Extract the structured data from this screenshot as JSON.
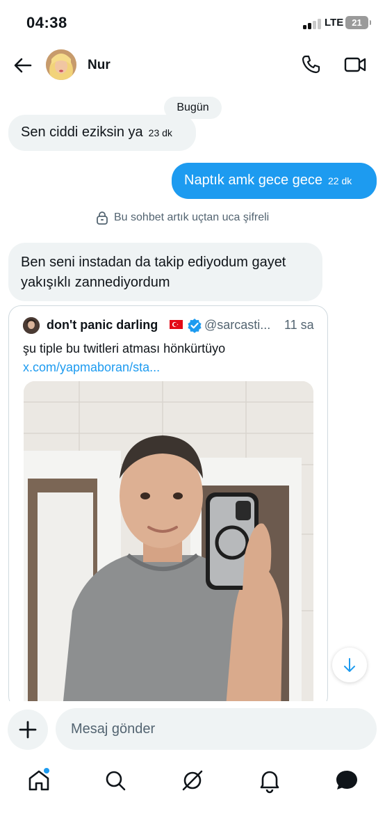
{
  "status_bar": {
    "time": "04:38",
    "network": "LTE",
    "battery": "21"
  },
  "header": {
    "contact_name": "Nur"
  },
  "chat": {
    "day_label": "Bugün",
    "messages": [
      {
        "direction": "incoming",
        "text": "Sen ciddi eziksin ya",
        "time": "23 dk"
      },
      {
        "direction": "outgoing",
        "text": "Naptık amk gece gece",
        "time": "22 dk"
      }
    ],
    "encryption_note": "Bu sohbet artık uçtan uca şifreli",
    "message3": {
      "direction": "incoming",
      "text": "Ben seni instadan da takip ediyodum gayet yakışıklı zannediyordum"
    }
  },
  "quoted_tweet": {
    "author_name": "don't panic darling",
    "handle": "@sarcasti...",
    "time": "11 sa",
    "text": "şu tiple bu twitleri atması hönkürtüyo ",
    "link": "x.com/yapmaboran/sta..."
  },
  "composer": {
    "placeholder": "Mesaj gönder"
  },
  "colors": {
    "accent": "#1d9bf0",
    "bubble_incoming": "#eff3f4",
    "text_secondary": "#536471"
  },
  "nav": {
    "items": [
      "home-icon",
      "search-icon",
      "grok-icon",
      "notifications-icon",
      "messages-icon"
    ]
  }
}
